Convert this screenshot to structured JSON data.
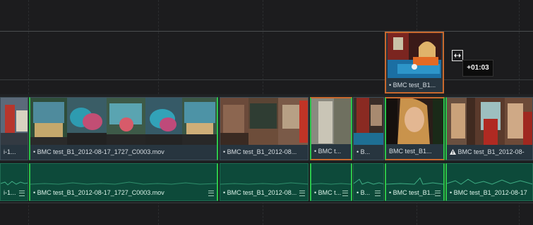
{
  "timeline": {
    "v2_clip": {
      "label": "• BMC test_B1..."
    },
    "tooltip": {
      "text": "+01:03"
    },
    "video_clips": [
      {
        "label": "i-1..."
      },
      {
        "label": "• BMC test_B1_2012-08-17_1727_C0003.mov"
      },
      {
        "label": "• BMC test_B1_2012-08..."
      },
      {
        "label": "• BMC t..."
      },
      {
        "label": "• B..."
      },
      {
        "label": "BMC test_B1..."
      },
      {
        "label": "BMC test_B1_2012-08-"
      }
    ],
    "audio_clips": [
      {
        "label": "i-1..."
      },
      {
        "label": "• BMC test_B1_2012-08-17_1727_C0003.mov"
      },
      {
        "label": "• BMC test_B1_2012-08..."
      },
      {
        "label": "• BMC t..."
      },
      {
        "label": "• B..."
      },
      {
        "label": "• BMC test_B1..."
      },
      {
        "label": "• BMC test_B1_2012-08-17"
      }
    ]
  },
  "icons": {
    "warning": "warning-icon",
    "trim_cursor": "trim-cursor-icon",
    "clip_menu": "clip-menu-icon"
  },
  "colors": {
    "selection": "#c8692e",
    "edit_point": "#2bc54b",
    "audio_clip": "#0d4a3a",
    "video_clip_label": "#27353f"
  }
}
